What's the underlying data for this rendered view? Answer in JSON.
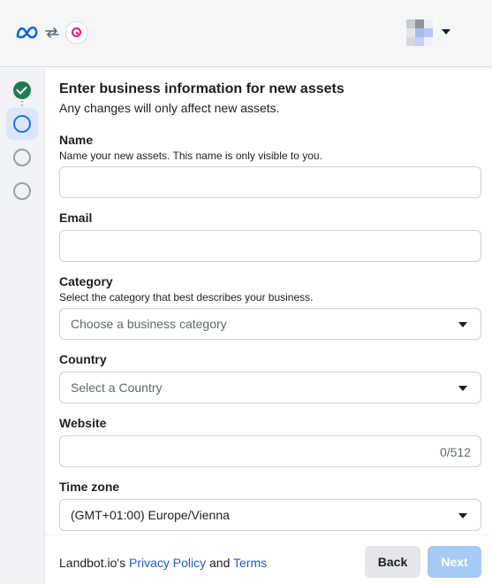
{
  "header": {
    "logo_icon": "meta-logo-icon",
    "sync_icon": "sync-arrows-icon",
    "app_icon": "landbot-app-icon",
    "account_menu_icon": "chevron-down-icon"
  },
  "stepper": {
    "steps": [
      "completed",
      "current",
      "upcoming",
      "upcoming"
    ]
  },
  "form": {
    "title": "Enter business information for new assets",
    "subtitle": "Any changes will only affect new assets.",
    "name": {
      "label": "Name",
      "help": "Name your new assets. This name is only visible to you.",
      "value": ""
    },
    "email": {
      "label": "Email",
      "value": ""
    },
    "category": {
      "label": "Category",
      "help": "Select the category that best describes your business.",
      "placeholder": "Choose a business category"
    },
    "country": {
      "label": "Country",
      "placeholder": "Select a Country"
    },
    "website": {
      "label": "Website",
      "value": "",
      "counter": "0/512"
    },
    "timezone": {
      "label": "Time zone",
      "value": "(GMT+01:00) Europe/Vienna"
    }
  },
  "footer": {
    "prefix": "Landbot.io's ",
    "privacy_link": "Privacy Policy",
    "and": " and ",
    "terms_link": "Terms",
    "back_label": "Back",
    "next_label": "Next"
  },
  "colors": {
    "accent": "#1877f2",
    "link": "#1d5fb9",
    "step_done": "#1f7a55",
    "next_disabled": "#a7c9f5"
  }
}
